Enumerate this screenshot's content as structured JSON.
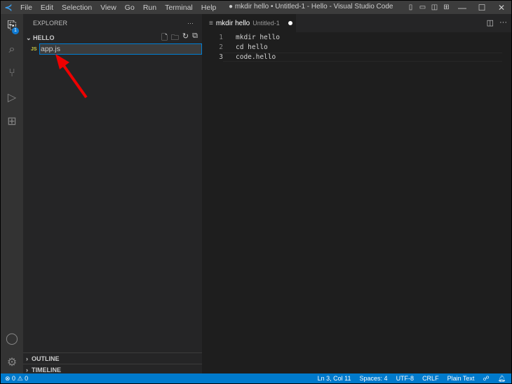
{
  "titlebar": {
    "menus": [
      "File",
      "Edit",
      "Selection",
      "View",
      "Go",
      "Run",
      "Terminal",
      "Help"
    ],
    "title": "● mkdir hello • Untitled-1 - Hello - Visual Studio Code"
  },
  "activity": {
    "explorer_badge": "1"
  },
  "sidebar": {
    "header": "EXPLORER",
    "more": "···",
    "folder": "HELLO",
    "file_icon": "JS",
    "rename_value": "app.js",
    "outline": "OUTLINE",
    "timeline": "TIMELINE"
  },
  "tab": {
    "title": "mkdir hello",
    "subtitle": "Untitled-1"
  },
  "editor": {
    "lines": [
      {
        "n": "1",
        "text": "mkdir hello"
      },
      {
        "n": "2",
        "text": "cd hello"
      },
      {
        "n": "3",
        "text": "code.hello"
      }
    ]
  },
  "status": {
    "errors": "0",
    "warnings": "0",
    "position": "Ln 3, Col 11",
    "spaces": "Spaces: 4",
    "encoding": "UTF-8",
    "eol": "CRLF",
    "language": "Plain Text"
  }
}
